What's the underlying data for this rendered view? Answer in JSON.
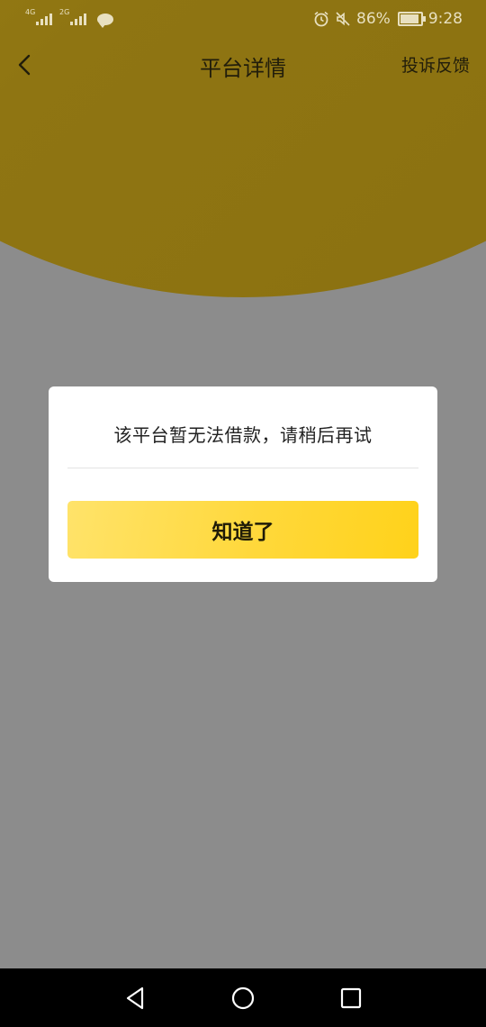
{
  "status_bar": {
    "sim1_network": "4G",
    "sim2_network": "2G",
    "battery_percent": "86%",
    "battery_level": 0.86,
    "time": "9:28",
    "icons": [
      "signal-icon",
      "signal-icon",
      "chat-icon",
      "alarm-icon",
      "mute-icon",
      "battery-icon"
    ]
  },
  "header": {
    "title": "平台详情",
    "feedback_label": "投诉反馈",
    "accent_color": "#8f7512"
  },
  "dialog": {
    "message": "该平台暂无法借款，请稍后再试",
    "confirm_label": "知道了",
    "button_color": "#ffd83a"
  },
  "system_nav": {
    "icons": [
      "back-triangle-icon",
      "home-circle-icon",
      "recents-square-icon"
    ]
  }
}
